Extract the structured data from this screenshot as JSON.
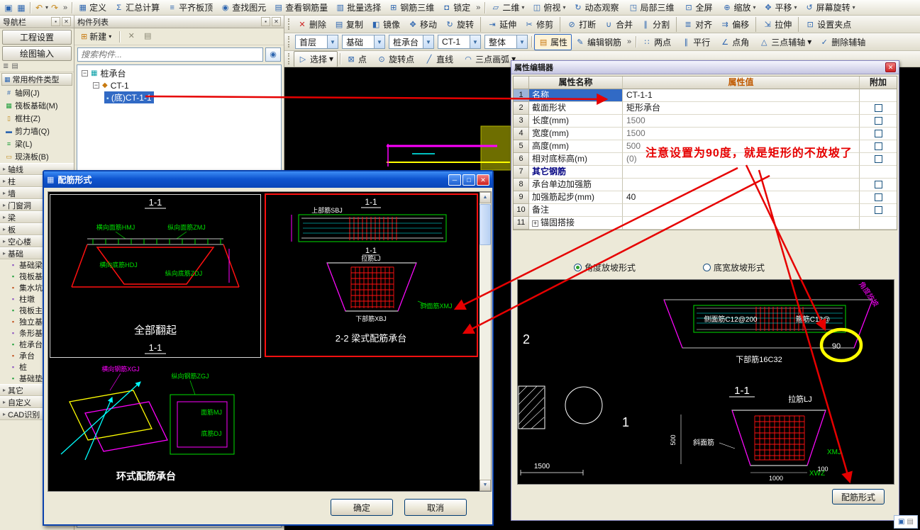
{
  "colors": {
    "selection_blue": "#316ac5",
    "annotation_red": "#e60000",
    "highlight_yellow": "#ffff00",
    "dialog_title_blue": "#0f55d0",
    "value_header_orange": "#c05a00",
    "cad_green": "#00e000",
    "cad_magenta": "#ff00ff",
    "cad_cyan": "#00ffff",
    "cad_red": "#ff1010"
  },
  "menubar": {
    "overflow": "»",
    "items": [
      {
        "icon": "define-icon",
        "glyph": "▦",
        "label": "定义",
        "arrow": ""
      },
      {
        "icon": "summary-calc-icon",
        "glyph": "Σ",
        "label": "汇总计算",
        "arrow": ""
      },
      {
        "icon": "align-slab-top-icon",
        "glyph": "≡",
        "label": "平齐板顶",
        "arrow": ""
      },
      {
        "icon": "find-element-icon",
        "glyph": "◉",
        "label": "查找图元",
        "arrow": ""
      },
      {
        "icon": "view-rebar-amount-icon",
        "glyph": "▤",
        "label": "查看钢筋量",
        "arrow": ""
      },
      {
        "icon": "batch-select-icon",
        "glyph": "▥",
        "label": "批量选择",
        "arrow": ""
      },
      {
        "icon": "rebar-3d-icon",
        "glyph": "⊞",
        "label": "钢筋三维",
        "arrow": ""
      },
      {
        "icon": "lock-icon",
        "glyph": "◘",
        "label": "锁定",
        "arrow": ""
      }
    ],
    "view_items": [
      {
        "icon": "view-2d-icon",
        "glyph": "▱",
        "label": "二维",
        "arrow": "▾"
      },
      {
        "icon": "top-view-icon",
        "glyph": "◫",
        "label": "俯视",
        "arrow": "▾"
      },
      {
        "icon": "orbit-icon",
        "glyph": "↻",
        "label": "动态观察",
        "arrow": ""
      },
      {
        "icon": "local-3d-icon",
        "glyph": "◳",
        "label": "局部三维",
        "arrow": ""
      },
      {
        "icon": "fullscreen-icon",
        "glyph": "⊡",
        "label": "全屏",
        "arrow": ""
      },
      {
        "icon": "zoom-icon",
        "glyph": "⊕",
        "label": "缩放",
        "arrow": "▾"
      },
      {
        "icon": "pan-icon",
        "glyph": "✥",
        "label": "平移",
        "arrow": "▾"
      },
      {
        "icon": "screen-rotate-icon",
        "glyph": "↺",
        "label": "屏幕旋转",
        "arrow": "▾"
      }
    ]
  },
  "left_nav": {
    "title": "导航栏",
    "tabs": [
      "工程设置",
      "绘图输入"
    ],
    "section_header": "常用构件类型",
    "common_items": [
      {
        "icon": "axis-grid-icon",
        "glyph": "#",
        "label": "轴网(J)"
      },
      {
        "icon": "raft-slab-icon",
        "glyph": "▦",
        "label": "筏板基础(M)"
      },
      {
        "icon": "frame-column-icon",
        "glyph": "▯",
        "label": "框柱(Z)"
      },
      {
        "icon": "shear-wall-icon",
        "glyph": "▬",
        "label": "剪力墙(Q)"
      },
      {
        "icon": "beam-icon",
        "glyph": "≡",
        "label": "梁(L)"
      },
      {
        "icon": "cast-slab-icon",
        "glyph": "▭",
        "label": "现浇板(B)"
      }
    ],
    "groups": [
      "轴线",
      "柱",
      "墙",
      "门窗洞",
      "梁",
      "板",
      "空心楼",
      "基础"
    ],
    "foundation_items": [
      "基础梁",
      "筏板基础",
      "集水坑",
      "柱墩",
      "筏板主筋",
      "独立基础",
      "条形基础",
      "桩承台",
      "承台",
      "桩",
      "基础垫层"
    ],
    "bottom_groups": [
      "其它",
      "自定义",
      "CAD识别"
    ]
  },
  "component_list": {
    "title": "构件列表",
    "new_button": "新建",
    "search_placeholder": "搜索构件...",
    "tree": {
      "root": "桩承台",
      "root_glyph": "▦",
      "child": "CT-1",
      "child_glyph": "◆",
      "leaf": "(底)CT-1-1",
      "leaf_glyph": "▪"
    }
  },
  "edit_toolbar": [
    {
      "icon": "delete-icon",
      "glyph": "✕",
      "label": "删除",
      "cls": "tb"
    },
    {
      "icon": "copy-icon",
      "glyph": "▤",
      "label": "复制",
      "cls": "tb"
    },
    {
      "icon": "mirror-icon",
      "glyph": "◧",
      "label": "镜像",
      "cls": "tb"
    },
    {
      "icon": "move-icon",
      "glyph": "✥",
      "label": "移动",
      "cls": "tb"
    },
    {
      "icon": "rotate-icon",
      "glyph": "↻",
      "label": "旋转",
      "cls": "tb"
    },
    {
      "icon": "extend-icon",
      "glyph": "⇥",
      "label": "延伸",
      "cls": "tb sepb"
    },
    {
      "icon": "trim-icon",
      "glyph": "✂",
      "label": "修剪",
      "cls": "tb"
    },
    {
      "icon": "break-icon",
      "glyph": "⊘",
      "label": "打断",
      "cls": "tb sepb"
    },
    {
      "icon": "merge-icon",
      "glyph": "∪",
      "label": "合并",
      "cls": "tb"
    },
    {
      "icon": "split-icon",
      "glyph": "∥",
      "label": "分割",
      "cls": "tb"
    },
    {
      "icon": "align-icon",
      "glyph": "≣",
      "label": "对齐",
      "cls": "tb sepb"
    },
    {
      "icon": "offset-icon",
      "glyph": "⇉",
      "label": "偏移",
      "cls": "tb"
    },
    {
      "icon": "stretch-icon",
      "glyph": "⇲",
      "label": "拉伸",
      "cls": "tb sepb"
    },
    {
      "icon": "set-grips-icon",
      "glyph": "⊡",
      "label": "设置夹点",
      "cls": "tb sepb"
    }
  ],
  "context_toolbar": {
    "combos": [
      "首层",
      "基础",
      "桩承台",
      "CT-1",
      "整体"
    ],
    "property_button": {
      "icon": "property-icon",
      "glyph": "▤",
      "label": "属性"
    },
    "edit_rebar_button": {
      "icon": "edit-rebar-icon",
      "glyph": "✎",
      "label": "编辑钢筋"
    },
    "overflow": "»",
    "axis_buttons": [
      {
        "icon": "two-point-axis-icon",
        "glyph": "∷",
        "label": "两点",
        "arrow": ""
      },
      {
        "icon": "parallel-axis-icon",
        "glyph": "∥",
        "label": "平行",
        "arrow": ""
      },
      {
        "icon": "point-angle-axis-icon",
        "glyph": "∠",
        "label": "点角",
        "arrow": ""
      },
      {
        "icon": "three-point-aux-axis-icon",
        "glyph": "△",
        "label": "三点辅轴",
        "arrow": "▾"
      },
      {
        "icon": "delete-aux-axis-icon",
        "glyph": "✓",
        "label": "删除辅轴",
        "arrow": ""
      }
    ]
  },
  "draw_toolbar": {
    "select_button": {
      "icon": "select-cursor-icon",
      "glyph": "▷",
      "label": "选择",
      "arrow": "▾"
    },
    "items": [
      {
        "icon": "point-tool-icon",
        "glyph": "⊠",
        "label": "点",
        "arrow": ""
      },
      {
        "icon": "rotate-point-tool-icon",
        "glyph": "⊙",
        "label": "旋转点",
        "arrow": ""
      },
      {
        "icon": "line-tool-icon",
        "glyph": "╱",
        "label": "直线",
        "arrow": ""
      },
      {
        "icon": "three-point-arc-icon",
        "glyph": "◠",
        "label": "三点画弧",
        "arrow": "▾"
      }
    ]
  },
  "property_editor": {
    "title": "属性编辑器",
    "col_name": "属性名称",
    "col_value": "属性值",
    "col_extra": "附加",
    "rows": [
      {
        "num": "1",
        "name": "名称",
        "value": "CT-1-1"
      },
      {
        "num": "2",
        "name": "截面形状",
        "value": "矩形承台"
      },
      {
        "num": "3",
        "name": "长度(mm)",
        "value": "1500"
      },
      {
        "num": "4",
        "name": "宽度(mm)",
        "value": "1500"
      },
      {
        "num": "5",
        "name": "高度(mm)",
        "value": "500"
      },
      {
        "num": "6",
        "name": "相对底标高(m)",
        "value": "(0)"
      },
      {
        "num": "7",
        "name": "其它钢筋",
        "value": ""
      },
      {
        "num": "8",
        "name": "承台单边加强筋",
        "value": ""
      },
      {
        "num": "9",
        "name": "加强筋起步(mm)",
        "value": "40"
      },
      {
        "num": "10",
        "name": "备注",
        "value": ""
      },
      {
        "num": "11",
        "name": "锚固搭接",
        "value": ""
      }
    ],
    "radio_angle": "角度放坡形式",
    "radio_width": "底宽放坡形式",
    "rebar_form_button": "配筋形式"
  },
  "prop_preview": {
    "num2": "2",
    "num1": "1",
    "dim1500": "1500",
    "label_cmj": "侧面筋C12@200",
    "label_gj": "箍筋C12@",
    "deg90": "90",
    "label_xbj": "下部筋16C32",
    "sec11": "1-1",
    "label_lj": "拉筋LJ",
    "label_xm": "斜面筋",
    "label_xmj": "XMJ",
    "label_xwz": "XWZ",
    "dim500": "500",
    "dim1000": "1000",
    "dim100": "100",
    "slope_label": "角度放坡"
  },
  "rebar_dialog": {
    "title": "配筋形式",
    "ok_button": "确定",
    "cancel_button": "取消",
    "cell1": {
      "title": "1-1",
      "hmj": "横向面筋HMJ",
      "zmj": "纵向面筋ZMJ",
      "hdj": "横向底筋HDJ",
      "zdj": "纵向底筋ZDJ",
      "caption": "全部翻起",
      "sub": "1-1"
    },
    "cell2": {
      "title": "1-1",
      "sbj": "上部筋SBJ",
      "mid": "1-1",
      "lj": "拉筋LJ",
      "xmj": "斜面筋XMJ",
      "xbj": "下部筋XBJ",
      "caption": "2-2 梁式配筋承台"
    },
    "cell3": {
      "xgj": "横向钢筋XGJ",
      "zgj": "纵向钢筋ZGJ",
      "mj": "面筋MJ",
      "dj": "底筋DJ",
      "caption": "环式配筋承台"
    }
  },
  "annotation": {
    "note": "注意设置为90度，就是矩形的不放坡了"
  }
}
